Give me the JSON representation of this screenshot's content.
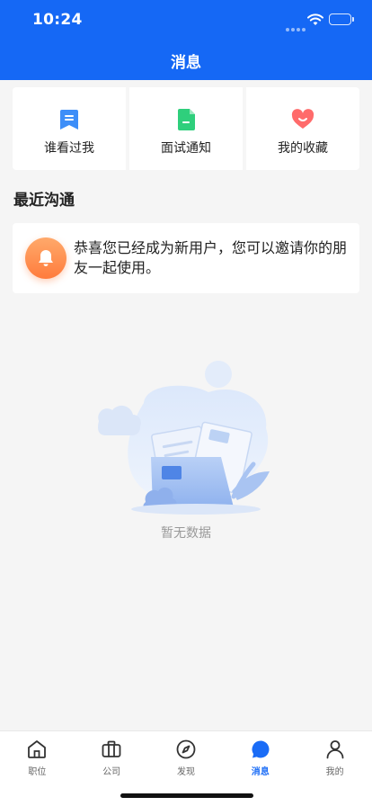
{
  "status_bar": {
    "time": "10:24"
  },
  "header": {
    "title": "消息"
  },
  "shortcuts": [
    {
      "label": "谁看过我",
      "icon": "bookmark-icon",
      "color": "#3d8ef8"
    },
    {
      "label": "面试通知",
      "icon": "document-icon",
      "color": "#2fcf7c"
    },
    {
      "label": "我的收藏",
      "icon": "heart-icon",
      "color": "#ff6b6b"
    }
  ],
  "recent": {
    "title": "最近沟通",
    "notice": {
      "icon": "bell-icon",
      "text": "恭喜您已经成为新用户，您可以邀请你的朋友一起使用。"
    }
  },
  "empty_state": {
    "text": "暂无数据",
    "illustration": "empty-folder-illustration"
  },
  "tabbar": {
    "active_color": "#1a6cf6",
    "items": [
      {
        "label": "职位",
        "icon": "home-icon"
      },
      {
        "label": "公司",
        "icon": "briefcase-icon"
      },
      {
        "label": "发现",
        "icon": "compass-icon"
      },
      {
        "label": "消息",
        "icon": "chat-bubble-icon",
        "active": true
      },
      {
        "label": "我的",
        "icon": "person-icon"
      }
    ]
  },
  "colors": {
    "primary": "#1568f5",
    "background": "#f5f5f5"
  }
}
